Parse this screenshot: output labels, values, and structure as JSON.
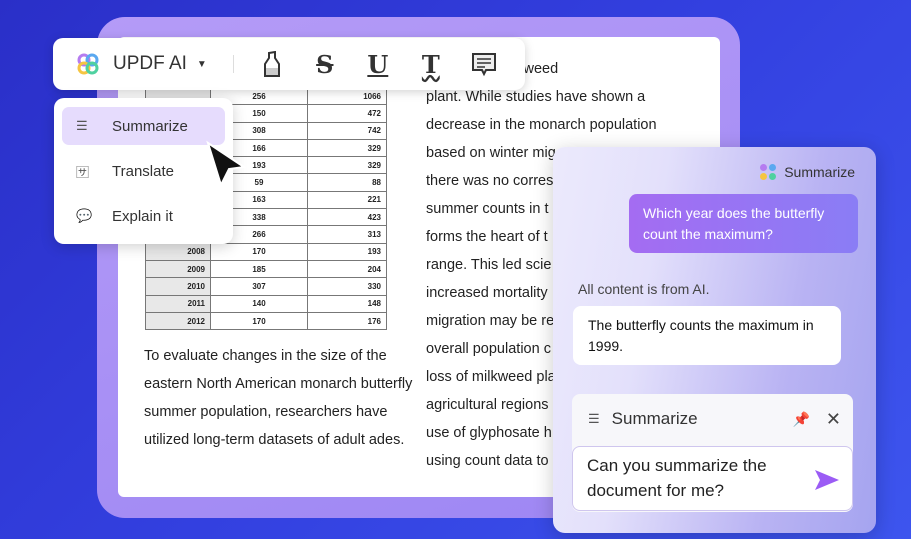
{
  "toolbar": {
    "brand": "UPDF AI",
    "tools": [
      "highlight-icon",
      "strikethrough-icon",
      "underline-icon",
      "squiggly-text-icon",
      "comment-icon"
    ]
  },
  "menu": {
    "items": [
      {
        "label": "Summarize",
        "icon": "list-icon"
      },
      {
        "label": "Translate",
        "icon": "translate-icon"
      },
      {
        "label": "Explain it",
        "icon": "explain-icon"
      }
    ]
  },
  "document": {
    "table": [
      [
        "",
        "256",
        "1066"
      ],
      [
        "",
        "150",
        "472"
      ],
      [
        "",
        "308",
        "742"
      ],
      [
        "",
        "166",
        "329"
      ],
      [
        "",
        "193",
        "329"
      ],
      [
        "",
        "59",
        "88"
      ],
      [
        "",
        "163",
        "221"
      ],
      [
        "",
        "338",
        "423"
      ],
      [
        "",
        "266",
        "313"
      ],
      [
        "2008",
        "170",
        "193"
      ],
      [
        "2009",
        "185",
        "204"
      ],
      [
        "2010",
        "307",
        "330"
      ],
      [
        "2011",
        "140",
        "148"
      ],
      [
        "2012",
        "170",
        "176"
      ]
    ],
    "left_paragraph": "To evaluate changes in the size of the eastern North American monarch butterfly summer population, researchers have utilized long-term datasets of adult ades.",
    "right_lines": [
      "counts per milkweed",
      "plant. While studies have shown a",
      "decrease in the monarch population",
      "based on winter mig",
      "there was no corres",
      "summer counts in t",
      "forms the heart of t",
      "range. This led scie",
      "increased mortality",
      "migration may be re",
      "overall population c",
      "loss of milkweed pla",
      "agricultural regions",
      "use of glyphosate h",
      "using count data to"
    ]
  },
  "panel": {
    "title": "Summarize",
    "question": "Which year does the butterfly count the maximum?",
    "note": "All content is from AI.",
    "answer": "The butterfly counts the maximum in 1999.",
    "mode": "Summarize",
    "input": "Can you summarize the document for me?"
  },
  "colors": {
    "accent": "#9b6cf3",
    "background": "#2f3bd8",
    "frame": "#a98cf5"
  }
}
